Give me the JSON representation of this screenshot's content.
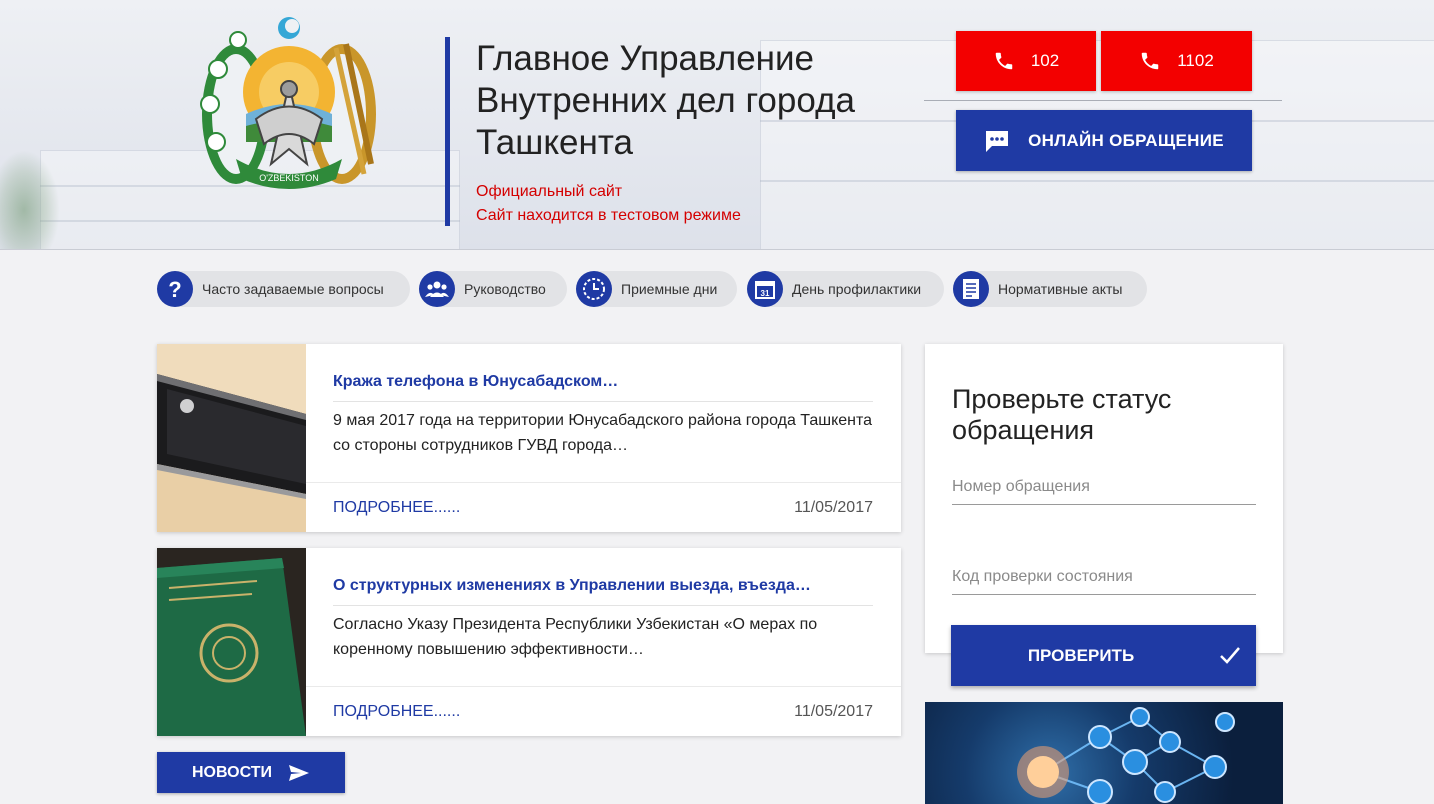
{
  "header": {
    "title": "Главное Управление Внутренних дел города Ташкента",
    "subtitle_1": "Официальный сайт",
    "subtitle_2": "Сайт находится в тестовом режиме",
    "emblem_ribbon": "O'ZBEKISTON",
    "phone_1": "102",
    "phone_2": "1102",
    "online_label": "ОНЛАЙН ОБРАЩЕНИЕ"
  },
  "quick_links": [
    {
      "label": "Часто задаваемые вопросы",
      "icon": "question-icon"
    },
    {
      "label": "Руководство",
      "icon": "people-icon"
    },
    {
      "label": "Приемные дни",
      "icon": "clock-icon"
    },
    {
      "label": "День профилактики",
      "icon": "calendar-icon"
    },
    {
      "label": "Нормативные акты",
      "icon": "document-icon"
    }
  ],
  "calendar_day": "31",
  "news": [
    {
      "title": "Кража телефона в Юнусабадском…",
      "text": "9 мая 2017 года на территории Юнусабадского района города Ташкента со стороны сотрудников ГУВД города…",
      "more": "ПОДРОБНЕЕ......",
      "date": "11/05/2017"
    },
    {
      "title": "О структурных изменениях в Управлении выезда, въезда…",
      "text": "Согласно Указу Президента Республики Узбекистан «О мерах по коренному повышению эффективности…",
      "more": "ПОДРОБНЕЕ......",
      "date": "11/05/2017"
    }
  ],
  "news_button": "НОВОСТИ",
  "status_panel": {
    "title": "Проверьте статус обращения",
    "number_placeholder": "Номер обращения",
    "code_placeholder": "Код проверки состояния",
    "check_label": "ПРОВЕРИТЬ"
  },
  "colors": {
    "brand_blue": "#1f3aa4",
    "alert_red": "#f30000",
    "subtitle_red": "#d40000"
  }
}
